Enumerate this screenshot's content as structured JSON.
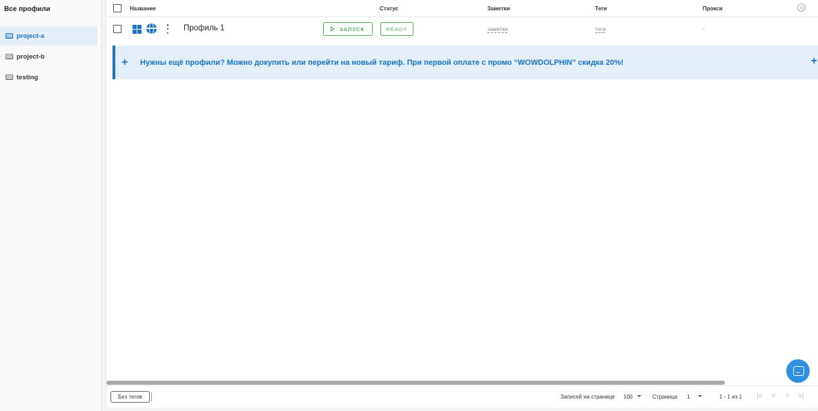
{
  "sidebar": {
    "title": "Все профили",
    "items": [
      {
        "label": "project-a",
        "icon": "folder-icon",
        "active": true
      },
      {
        "label": "project-b",
        "icon": "folder-icon",
        "active": false
      },
      {
        "label": "testing",
        "icon": "folder-icon",
        "active": false
      }
    ]
  },
  "table": {
    "headers": {
      "name": "Название",
      "status": "Статус",
      "notes": "Заметки",
      "tags": "Теги",
      "proxy": "Прокси"
    },
    "rows": [
      {
        "os_icon": "windows-icon",
        "browser_icon": "globe-icon",
        "name": "Профиль 1",
        "launch_label": "ЗАПУСК",
        "status": "READY",
        "notes": "заметки",
        "tags": "теги",
        "proxy": "-"
      }
    ]
  },
  "banner": {
    "text": "Нужны ещё профили? Можно докупить или перейти на новый тариф. При первой оплате с промо “WOWDOLPHIN” скидка 20%!",
    "plus": "+"
  },
  "footer": {
    "no_tags_label": "Без тегов",
    "rows_per_page_label": "Записей на странице",
    "rows_per_page_value": "100",
    "page_label": "Страница",
    "page_value": "1",
    "range_text": "1 - 1 из 1",
    "first_page": "|<",
    "prev_page": "<",
    "next_page": ">",
    "last_page": ">|"
  },
  "colors": {
    "accent": "#1a73c8",
    "success": "#4caf50",
    "banner_bg": "#e3eef9"
  }
}
